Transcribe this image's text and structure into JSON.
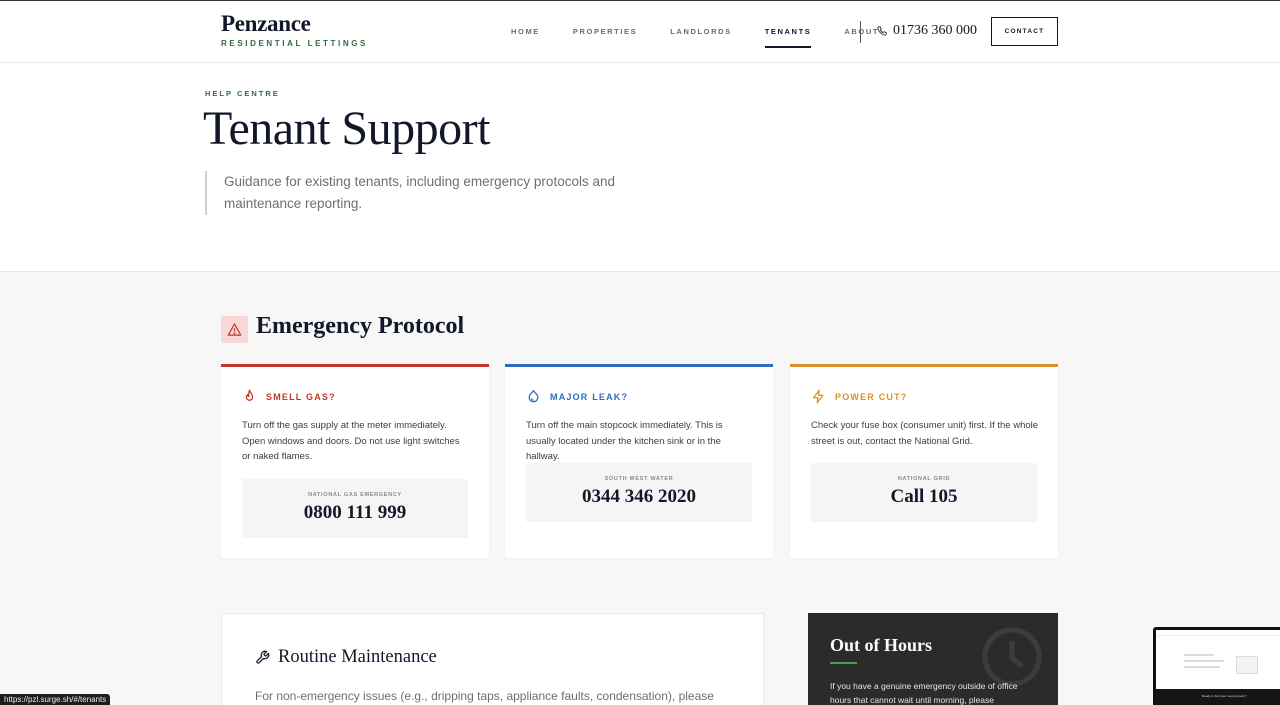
{
  "header": {
    "brand_name": "Penzance",
    "brand_sub": "RESIDENTIAL LETTINGS",
    "nav": [
      {
        "label": "HOME",
        "active": false
      },
      {
        "label": "PROPERTIES",
        "active": false
      },
      {
        "label": "LANDLORDS",
        "active": false
      },
      {
        "label": "TENANTS",
        "active": true
      },
      {
        "label": "ABOUT",
        "active": false
      }
    ],
    "phone": "01736 360 000",
    "phone_icon": "phone-icon",
    "contact_label": "CONTACT"
  },
  "hero": {
    "eyebrow": "HELP CENTRE",
    "title": "Tenant Support",
    "lead": "Guidance for existing tenants, including emergency protocols and maintenance reporting."
  },
  "emergency": {
    "icon": "warning-triangle-icon",
    "title": "Emergency Protocol",
    "cards": [
      {
        "icon": "flame-icon",
        "heading": "SMELL GAS?",
        "color": "#c0392b",
        "body": "Turn off the gas supply at the meter immediately. Open windows and doors. Do not use light switches or naked flames.",
        "hotline_label": "NATIONAL GAS EMERGENCY",
        "hotline_number": "0800 111 999"
      },
      {
        "icon": "droplet-icon",
        "heading": "MAJOR LEAK?",
        "color": "#2d6cc0",
        "body": "Turn off the main stopcock immediately. This is usually located under the kitchen sink or in the hallway.",
        "hotline_label": "SOUTH WEST WATER",
        "hotline_number": "0344 346 2020"
      },
      {
        "icon": "lightning-icon",
        "heading": "POWER CUT?",
        "color": "#d9902a",
        "body": "Check your fuse box (consumer unit) first. If the whole street is out, contact the National Grid.",
        "hotline_label": "NATIONAL GRID",
        "hotline_number": "Call 105"
      }
    ]
  },
  "routine": {
    "icon": "wrench-icon",
    "title": "Routine Maintenance",
    "body": "For non-emergency issues (e.g., dripping taps, appliance faults, condensation), please report"
  },
  "out_of_hours": {
    "title": "Out of Hours",
    "body": "If you have a genuine emergency outside of office hours that cannot wait until morning, please",
    "icon": "clock-icon"
  },
  "status_bar": {
    "url": "https://pzl.surge.sh/#/tenants"
  },
  "preview": {
    "footer_text": "Ready to find your next property?"
  }
}
